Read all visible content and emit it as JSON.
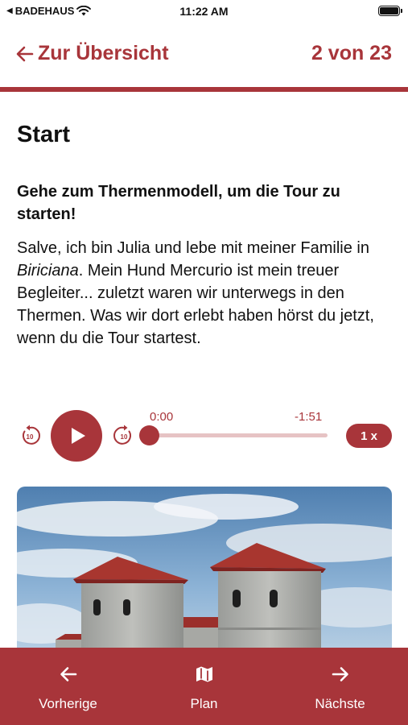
{
  "status_bar": {
    "carrier": "BADEHAUS",
    "time": "11:22 AM",
    "battery_percent": 100
  },
  "header": {
    "back_label": "Zur Übersicht",
    "position": "2 von 23"
  },
  "main": {
    "title": "Start",
    "instruction": "Gehe zum Thermenmodell, um die Tour zu starten!",
    "body_part1": "Salve, ich bin Julia und lebe mit meiner Familie in ",
    "body_emphasis": "Biriciana",
    "body_part2": ". Mein Hund Mercurio ist mein treuer Begleiter... zuletzt waren wir unterwegs in den Thermen. Was wir dort erlebt haben hörst du jetzt, wenn du die Tour startest."
  },
  "player": {
    "elapsed": "0:00",
    "remaining": "-1:51",
    "progress_fraction": 0.0,
    "speed": "1 x",
    "skip_back_seconds": "10",
    "skip_forward_seconds": "10"
  },
  "tabs": [
    {
      "label": "Vorherige",
      "icon": "arrow-left-icon"
    },
    {
      "label": "Plan",
      "icon": "map-icon"
    },
    {
      "label": "Nächste",
      "icon": "arrow-right-icon"
    }
  ],
  "colors": {
    "accent": "#a8353a",
    "track": "#e6c3c4",
    "background": "#ffffff"
  }
}
